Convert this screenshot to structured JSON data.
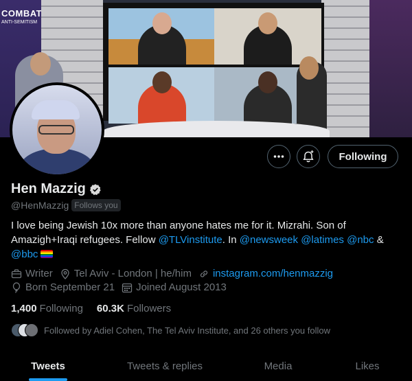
{
  "banner": {
    "logo_line1": "COMBAT",
    "logo_line2": "ANTI-SEMITISM"
  },
  "actions": {
    "following_label": "Following",
    "more_icon": "more-icon",
    "bell_icon": "notification-bell-icon"
  },
  "profile": {
    "name": "Hen Mazzig",
    "handle": "@HenMazzig",
    "follows_you": "Follows you",
    "bio": {
      "text1": "I love being Jewish 10x more than anyone hates me for it. Mizrahi. Son of Amazigh+Iraqi refugees. Fellow ",
      "link1": "@TLVinstitute",
      "text2": ". In ",
      "link2": "@newsweek",
      "link3": "@latimes",
      "link4": "@nbc",
      "text3": " & ",
      "link5": "@bbc"
    },
    "profession": "Writer",
    "location": "Tel Aviv - London | he/him",
    "website": "instagram.com/henmazzig",
    "birthday": "Born September 21",
    "joined": "Joined August 2013"
  },
  "stats": {
    "following_count": "1,400",
    "following_label": "Following",
    "followers_count": "60.3K",
    "followers_label": "Followers"
  },
  "followed_by": "Followed by Adiel Cohen, The Tel Aviv Institute, and 26 others you follow",
  "tabs": [
    {
      "label": "Tweets",
      "active": true
    },
    {
      "label": "Tweets & replies",
      "active": false
    },
    {
      "label": "Media",
      "active": false
    },
    {
      "label": "Likes",
      "active": false
    }
  ],
  "colors": {
    "accent": "#1d9bf0",
    "muted": "#71767b",
    "text": "#e7e9ea",
    "background": "#000000"
  }
}
